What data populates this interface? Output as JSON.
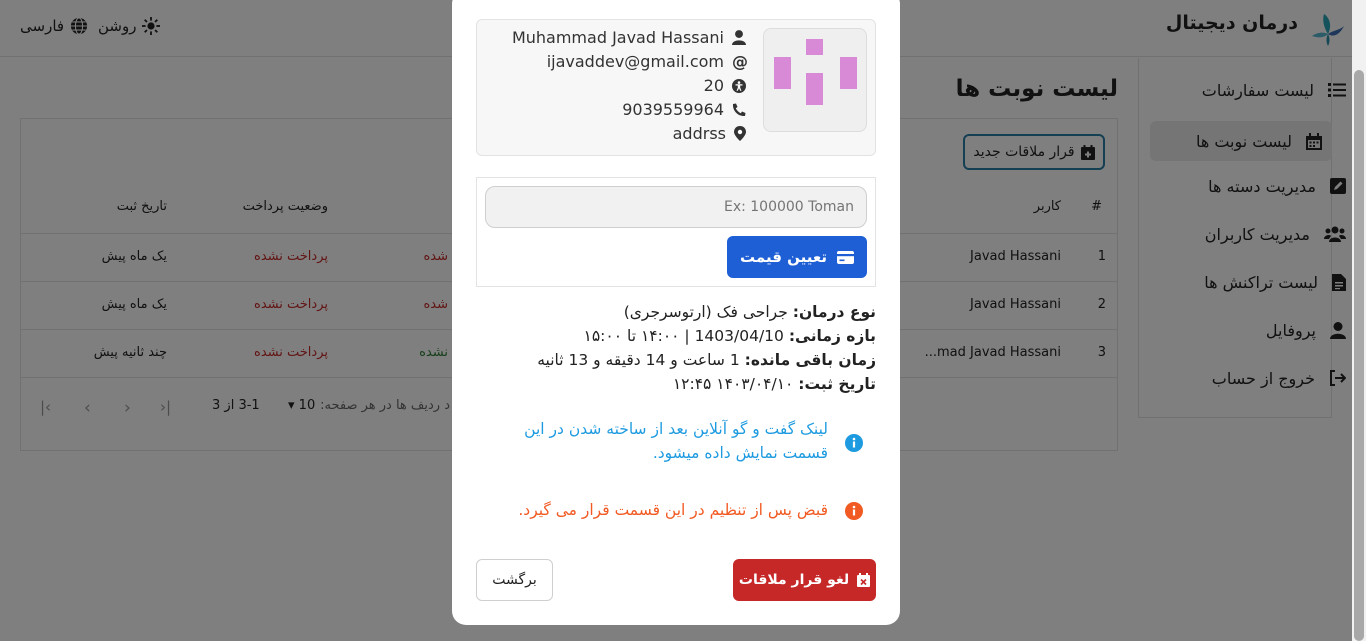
{
  "header": {
    "brand": "درمان دیجیتال",
    "theme_label": "روشن",
    "language_label": "فارسی"
  },
  "sidebar": {
    "items": [
      {
        "label": "لیست سفارشات",
        "icon": "list-icon"
      },
      {
        "label": "لیست نوبت ها",
        "icon": "calendar-icon"
      },
      {
        "label": "مدیریت دسته ها",
        "icon": "edit-icon"
      },
      {
        "label": "مدیریت کاربران",
        "icon": "users-icon"
      },
      {
        "label": "لیست تراکنش ها",
        "icon": "file-icon"
      },
      {
        "label": "پروفایل",
        "icon": "user-icon"
      },
      {
        "label": "خروج از حساب",
        "icon": "logout-icon"
      }
    ]
  },
  "main": {
    "title": "لیست نوبت ها",
    "new_button": "قرار ملاقات جدید",
    "columns": {
      "index": "#",
      "user": "کاربر",
      "payment_status": "وضعیت پرداخت",
      "created": "تاریخ ثبت"
    },
    "rows": [
      {
        "index": "1",
        "user": "Javad Hassani",
        "status_partial": "شده",
        "payment": "پرداخت نشده",
        "created": "یک ماه پیش"
      },
      {
        "index": "2",
        "user": "Javad Hassani",
        "status_partial": "شده",
        "payment": "پرداخت نشده",
        "created": "یک ماه پیش"
      },
      {
        "index": "3",
        "user": "...mad Javad Hassani",
        "status_partial": "نشده",
        "payment": "پرداخت نشده",
        "created": "چند ثانیه پیش"
      }
    ],
    "pagination": {
      "rows_label": "د ردیف ها در هر صفحه:",
      "rows_value": "10",
      "range": "3-1 از 3"
    }
  },
  "modal": {
    "profile": {
      "name": "Muhammad Javad Hassani",
      "email": "ijavaddev@gmail.com",
      "age": "20",
      "phone": "9039559964",
      "address": "addrss"
    },
    "price_placeholder": "Ex: 100000 Toman",
    "price_button": "تعیین قیمت",
    "details": {
      "type_label": "نوع درمان:",
      "type_value": "جراحی فک (ارتوسرجری)",
      "range_label": "بازه زمانی:",
      "range_value": "1403/04/10 | ۱۴:۰۰ تا ۱۵:۰۰",
      "remaining_label": "زمان باقی مانده:",
      "remaining_value": "1 ساعت و 14 دقیقه و 13 ثانیه",
      "created_label": "تاریخ ثبت:",
      "created_value": "۱۴۰۳/۰۴/۱۰ ۱۲:۴۵"
    },
    "note_link_1": "لینک گفت و گو آنلاین بعد از ساخته شدن در این",
    "note_link_2": "قسمت نمایش داده میشود.",
    "note_receipt": "قبض پس از تنظیم در این قسمت قرار می گیرد.",
    "cancel_button": "لغو قرار ملاقات",
    "back_button": "برگشت"
  },
  "colors": {
    "accent": "#1e5fd6",
    "danger": "#c62828",
    "info": "#1e9be0",
    "warning": "#f15a22",
    "avatar_pattern": "#d98ad6"
  }
}
